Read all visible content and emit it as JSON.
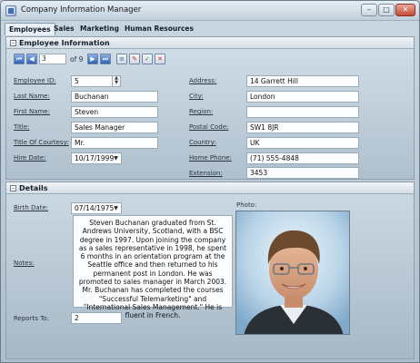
{
  "window": {
    "title": "Company Information Manager"
  },
  "tabs": [
    "Employees",
    "Sales",
    "Marketing",
    "Human Resources"
  ],
  "employee_group": {
    "title": "Employee Information",
    "position": "3",
    "count_text": "of 9"
  },
  "labels": {
    "employee_id": "Employee ID:",
    "last_name": "Last Name:",
    "first_name": "First Name:",
    "title": "Title:",
    "title_of_courtesy": "Title Of Courtesy:",
    "hire_date": "Hire Date:",
    "address": "Address:",
    "city": "City:",
    "region": "Region:",
    "postal_code": "Postal Code:",
    "country": "Country:",
    "home_phone": "Home Phone:",
    "extension": "Extension:"
  },
  "employee": {
    "employee_id": "5",
    "last_name": "Buchanan",
    "first_name": "Steven",
    "title": "Sales Manager",
    "title_of_courtesy": "Mr.",
    "hire_date": "10/17/1999",
    "address": "14 Garrett Hill",
    "city": "London",
    "region": "",
    "postal_code": "SW1 8JR",
    "country": "UK",
    "home_phone": "(71) 555-4848",
    "extension": "3453"
  },
  "details_group": {
    "title": "Details",
    "birth_date_label": "Birth Date:",
    "birth_date": "07/14/1975",
    "notes_label": "Notes:",
    "notes": "Steven Buchanan graduated from St. Andrews University, Scotland, with a BSC degree in 1997. Upon joining the company as a sales representative in 1998, he spent 6 months in an orientation program at the Seattle office and then returned to his permanent post in London. He was promoted to sales manager in March 2003. Mr. Buchanan has completed the courses \"Successful Telemarketing\" and \"International Sales Management.\" He is fluent in French.",
    "reports_to_label": "Reports To:",
    "reports_to": "2",
    "photo_label": "Photo:"
  }
}
